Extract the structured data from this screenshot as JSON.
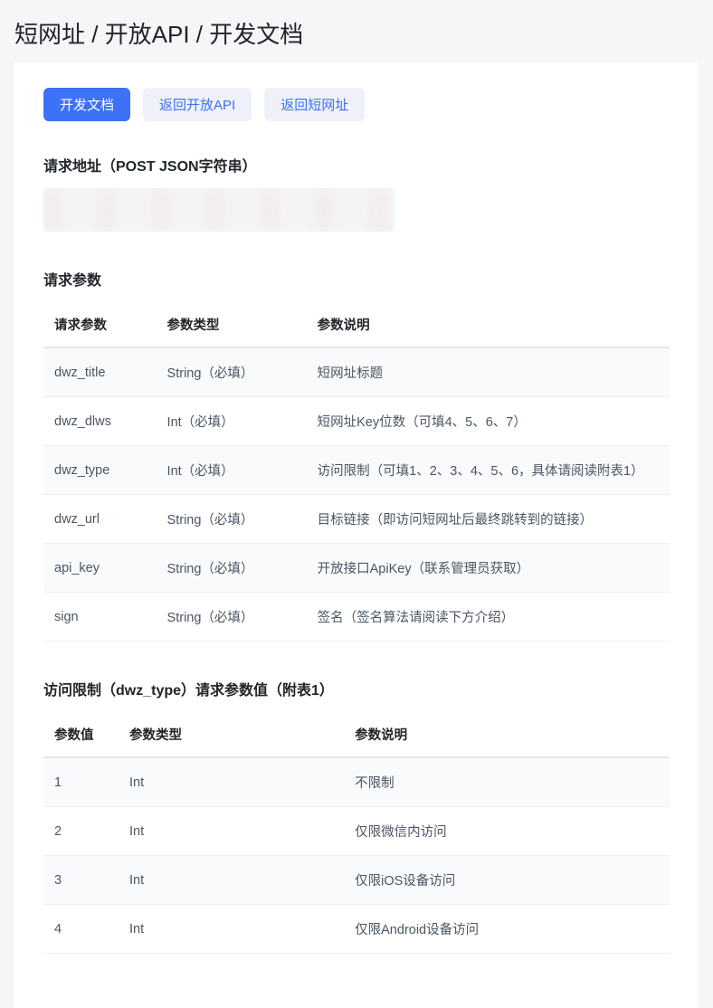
{
  "breadcrumb": "短网址 / 开放API / 开发文档",
  "tabs": {
    "dev_doc": "开发文档",
    "back_api": "返回开放API",
    "back_dwz": "返回短网址"
  },
  "section_request_url": {
    "title": "请求地址（POST JSON字符串）"
  },
  "section_request_params": {
    "title": "请求参数",
    "headers": {
      "c1": "请求参数",
      "c2": "参数类型",
      "c3": "参数说明"
    },
    "rows": [
      {
        "c1": "dwz_title",
        "c2": "String（必填）",
        "c3": "短网址标题"
      },
      {
        "c1": "dwz_dlws",
        "c2": "Int（必填）",
        "c3": "短网址Key位数（可填4、5、6、7）"
      },
      {
        "c1": "dwz_type",
        "c2": "Int（必填）",
        "c3": "访问限制（可填1、2、3、4、5、6，具体请阅读附表1）"
      },
      {
        "c1": "dwz_url",
        "c2": "String（必填）",
        "c3": "目标链接（即访问短网址后最终跳转到的链接）"
      },
      {
        "c1": "api_key",
        "c2": "String（必填）",
        "c3": "开放接口ApiKey（联系管理员获取）"
      },
      {
        "c1": "sign",
        "c2": "String（必填）",
        "c3": "签名（签名算法请阅读下方介绍）"
      }
    ]
  },
  "section_dwz_type": {
    "title": "访问限制（dwz_type）请求参数值（附表1）",
    "headers": {
      "c1": "参数值",
      "c2": "参数类型",
      "c3": "参数说明"
    },
    "rows": [
      {
        "c1": "1",
        "c2": "Int",
        "c3": "不限制"
      },
      {
        "c1": "2",
        "c2": "Int",
        "c3": "仅限微信内访问"
      },
      {
        "c1": "3",
        "c2": "Int",
        "c3": "仅限iOS设备访问"
      },
      {
        "c1": "4",
        "c2": "Int",
        "c3": "仅限Android设备访问"
      }
    ]
  }
}
